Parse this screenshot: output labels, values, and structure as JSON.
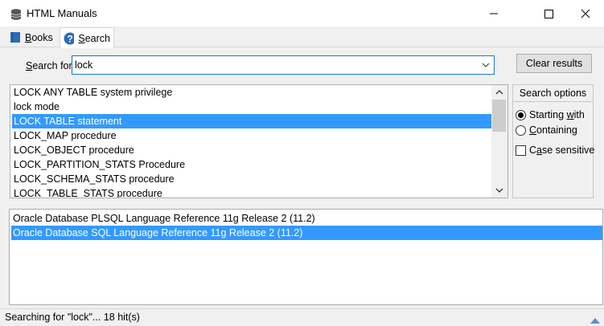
{
  "window": {
    "title": "HTML Manuals",
    "icon": "database-icon"
  },
  "tabs": [
    {
      "label": "Books",
      "accel": "B",
      "rest": "ooks",
      "icon": "book-icon",
      "active": false
    },
    {
      "label": "Search",
      "accel": "S",
      "rest": "earch",
      "icon": "help-icon",
      "active": true
    }
  ],
  "search": {
    "label_accel": "S",
    "label_rest": "earch for",
    "value": "lock",
    "clear_label": "Clear results"
  },
  "index_items": [
    "LOCK ANY TABLE system privilege",
    "lock mode",
    "LOCK TABLE statement",
    "LOCK_MAP procedure",
    "LOCK_OBJECT procedure",
    "LOCK_PARTITION_STATS Procedure",
    "LOCK_SCHEMA_STATS procedure",
    "LOCK_TABLE_STATS procedure"
  ],
  "index_selected": 2,
  "options": {
    "title": "Search options",
    "starting_with_accel": "w",
    "starting_with_pre": "Starting ",
    "starting_with_post": "ith",
    "containing_accel": "C",
    "containing_rest": "ontaining",
    "case_accel": "a",
    "case_pre": "C",
    "case_post": "se sensitive",
    "mode": "starting_with",
    "case_sensitive": false
  },
  "results": [
    "Oracle Database PLSQL Language Reference 11g Release 2 (11.2)",
    "Oracle Database SQL Language Reference 11g Release 2 (11.2)"
  ],
  "results_selected": 1,
  "status": {
    "text": "Searching for \"lock\"... 18 hit(s)"
  },
  "colors": {
    "selection": "#3399ff",
    "focus_border": "#1a73c9"
  }
}
